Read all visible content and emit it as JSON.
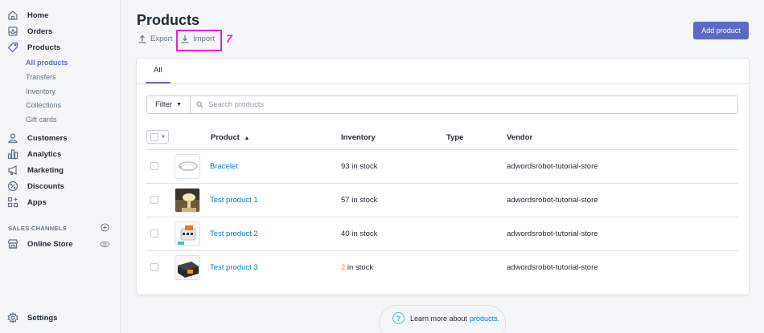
{
  "sidebar": {
    "items": [
      {
        "label": "Home",
        "icon": "home-icon"
      },
      {
        "label": "Orders",
        "icon": "orders-icon"
      },
      {
        "label": "Products",
        "icon": "tag-icon"
      },
      {
        "label": "Customers",
        "icon": "person-icon"
      },
      {
        "label": "Analytics",
        "icon": "bar-chart-icon"
      },
      {
        "label": "Marketing",
        "icon": "megaphone-icon"
      },
      {
        "label": "Discounts",
        "icon": "discount-icon"
      },
      {
        "label": "Apps",
        "icon": "apps-icon"
      }
    ],
    "product_subitems": [
      "All products",
      "Transfers",
      "Inventory",
      "Collections",
      "Gift cards"
    ],
    "active_subitem": "All products",
    "sales_channels_title": "SALES CHANNELS",
    "online_store": "Online Store",
    "settings": "Settings"
  },
  "header": {
    "title": "Products",
    "export_label": "Export",
    "import_label": "Import",
    "annotation_step": "7",
    "add_product_label": "Add product"
  },
  "tabs": [
    {
      "label": "All",
      "active": true
    }
  ],
  "filter": {
    "label": "Filter",
    "search_placeholder": "Search products"
  },
  "table": {
    "columns": [
      "Product",
      "Inventory",
      "Type",
      "Vendor"
    ],
    "rows": [
      {
        "name": "Bracelet",
        "inventory_count": "93",
        "inventory_suffix": " in stock",
        "type": "",
        "vendor": "adwordsrobot-tutorial-store"
      },
      {
        "name": "Test product 1",
        "inventory_count": "57",
        "inventory_suffix": " in stock",
        "type": "",
        "vendor": "adwordsrobot-tutorial-store"
      },
      {
        "name": "Test product 2",
        "inventory_count": "40",
        "inventory_suffix": " in stock",
        "type": "",
        "vendor": "adwordsrobot-tutorial-store"
      },
      {
        "name": "Test product 3",
        "inventory_count": "2",
        "inventory_suffix": " in stock",
        "type": "",
        "vendor": "adwordsrobot-tutorial-store",
        "low_stock": true
      }
    ]
  },
  "footer": {
    "learn_text": "Learn more about",
    "learn_link": "products."
  },
  "colors": {
    "accent": "#5c6ac4",
    "link": "#007ace",
    "annotation": "#e41ee0",
    "low_stock": "#f49342"
  }
}
